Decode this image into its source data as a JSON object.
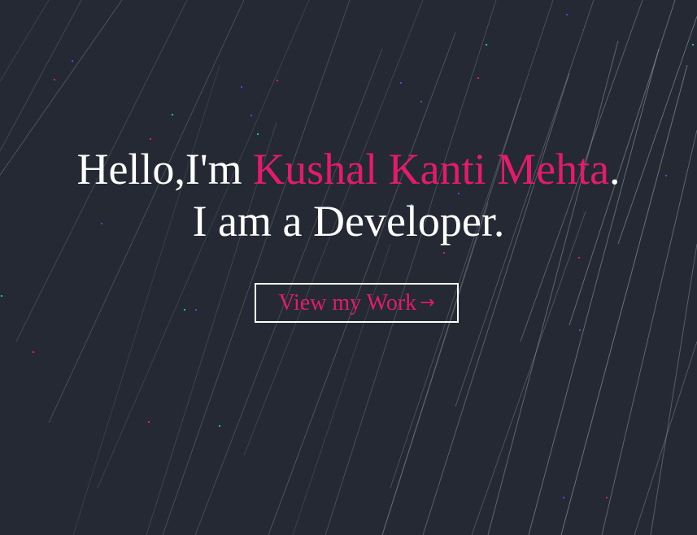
{
  "hero": {
    "greeting_prefix": "Hello,I'm ",
    "name": "Kushal Kanti Mehta",
    "greeting_suffix": ".",
    "subtitle": "I am a Developer.",
    "cta_label": "View my Work",
    "cta_icon": "arrow-right-icon",
    "cta_arrow_glyph": "→"
  },
  "colors": {
    "background": "#252934",
    "accent": "#e31b6d",
    "text": "#ffffff",
    "streak": "#9aa0ac",
    "dot_pink": "#e31b6d",
    "dot_cyan": "#04c2c9",
    "dot_blue": "#2e5bd1"
  }
}
